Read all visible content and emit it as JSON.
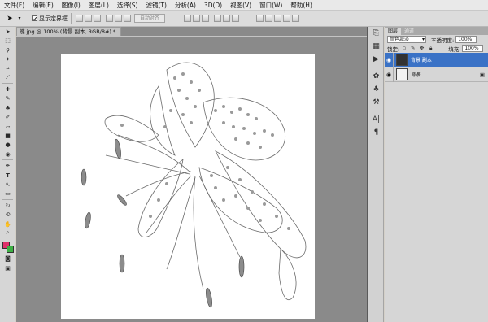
{
  "menu": [
    "文件(F)",
    "编辑(E)",
    "图像(I)",
    "图层(L)",
    "选择(S)",
    "滤镜(T)",
    "分析(A)",
    "3D(D)",
    "视图(V)",
    "窗口(W)",
    "帮助(H)"
  ],
  "options": {
    "checkbox_label": "显示定界框",
    "auto_align_label": "自动对齐"
  },
  "document": {
    "tab_title": "蝶.jpg @ 100% (背景 副本, RGB/8#) *",
    "close_glyph": "×"
  },
  "tools": [
    "move",
    "marquee",
    "lasso",
    "magic-wand",
    "crop",
    "eyedropper",
    "heal",
    "brush",
    "stamp",
    "history-brush",
    "eraser",
    "gradient",
    "blur",
    "dodge",
    "pen",
    "type",
    "path-select",
    "shape",
    "3d-rotate",
    "3d-orbit",
    "hand",
    "zoom"
  ],
  "swatches": {
    "foreground": "#e0306a",
    "background": "#3cb044"
  },
  "layers_panel": {
    "tabs": [
      "图层",
      "通道"
    ],
    "blend_mode": "颜色减淡",
    "opacity_label": "不透明度:",
    "opacity_value": "100%",
    "lock_label": "锁定:",
    "fill_label": "填充:",
    "fill_value": "100%",
    "layers": [
      {
        "name": "背景 副本",
        "selected": true,
        "visible": true
      },
      {
        "name": "背景",
        "selected": false,
        "visible": true,
        "locked": true
      }
    ]
  },
  "colors": {
    "selection": "#3a72c6",
    "workspace": "#8a8a8a"
  }
}
